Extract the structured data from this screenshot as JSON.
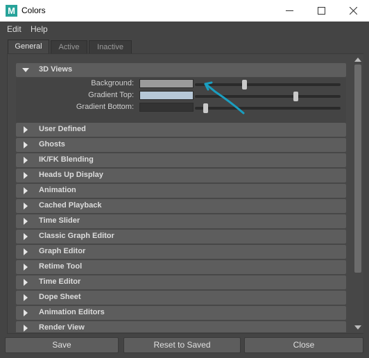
{
  "window": {
    "title": "Colors",
    "app_icon_letter": "M",
    "accent_color": "#28a39a"
  },
  "menubar": {
    "items": [
      "Edit",
      "Help"
    ]
  },
  "tabs": [
    {
      "label": "General",
      "active": true
    },
    {
      "label": "Active",
      "active": false
    },
    {
      "label": "Inactive",
      "active": false
    }
  ],
  "sections": {
    "expanded": {
      "label": "3D Views",
      "attributes": [
        {
          "label": "Background:",
          "color": "#9b9b9b",
          "slider_fraction": 0.34
        },
        {
          "label": "Gradient Top:",
          "color": "#b6c7d7",
          "slider_fraction": 0.69
        },
        {
          "label": "Gradient Bottom:",
          "color": "#333333",
          "slider_fraction": 0.07
        }
      ]
    },
    "collapsed": [
      "User Defined",
      "Ghosts",
      "IK/FK Blending",
      "Heads Up Display",
      "Animation",
      "Cached Playback",
      "Time Slider",
      "Classic Graph Editor",
      "Graph Editor",
      "Retime Tool",
      "Time Editor",
      "Dope Sheet",
      "Animation Editors",
      "Render View"
    ]
  },
  "buttons": {
    "save": "Save",
    "reset": "Reset to Saved",
    "close": "Close"
  },
  "annotation": {
    "color": "#1a9ec0",
    "icon": "arrow-annotation-icon"
  }
}
